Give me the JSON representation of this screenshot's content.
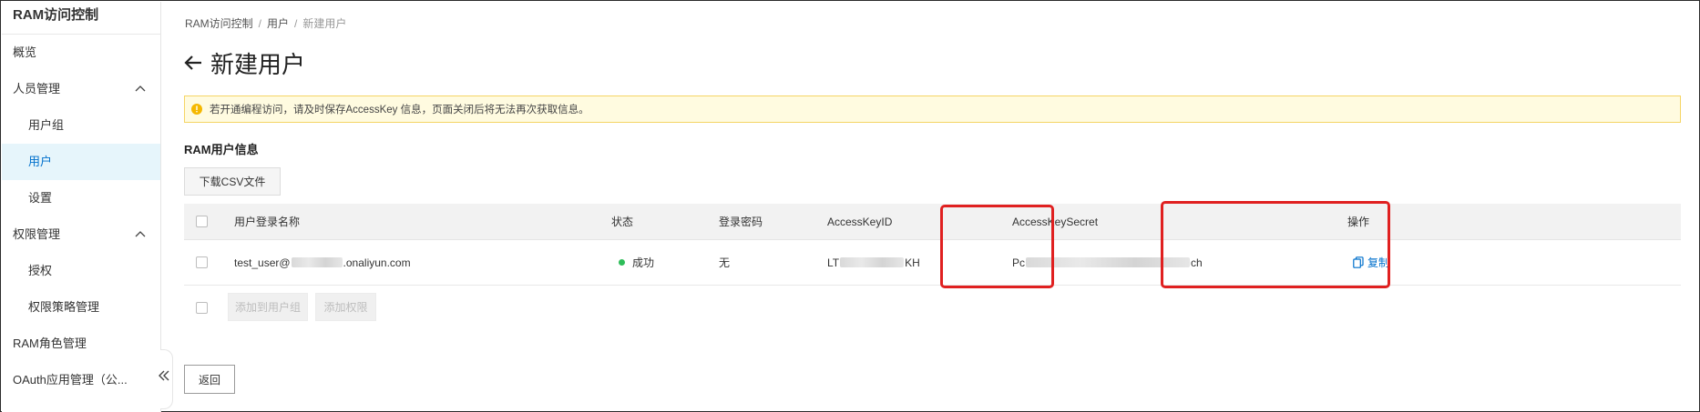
{
  "sidebar": {
    "title": "RAM访问控制",
    "items": [
      {
        "label": "概览",
        "level": 0,
        "active": false,
        "expandable": false
      },
      {
        "label": "人员管理",
        "level": 0,
        "active": false,
        "expandable": true
      },
      {
        "label": "用户组",
        "level": 1,
        "active": false,
        "expandable": false
      },
      {
        "label": "用户",
        "level": 1,
        "active": true,
        "expandable": false
      },
      {
        "label": "设置",
        "level": 1,
        "active": false,
        "expandable": false
      },
      {
        "label": "权限管理",
        "level": 0,
        "active": false,
        "expandable": true
      },
      {
        "label": "授权",
        "level": 1,
        "active": false,
        "expandable": false
      },
      {
        "label": "权限策略管理",
        "level": 1,
        "active": false,
        "expandable": false
      },
      {
        "label": "RAM角色管理",
        "level": 0,
        "active": false,
        "expandable": false
      },
      {
        "label": "OAuth应用管理（公...",
        "level": 0,
        "active": false,
        "expandable": false
      }
    ],
    "collapse_icon": "double-chevron-left-icon"
  },
  "breadcrumb": {
    "items": [
      "RAM访问控制",
      "用户"
    ],
    "current": "新建用户",
    "separator": "/"
  },
  "page": {
    "title": "新建用户",
    "back_icon": "arrow-left-icon"
  },
  "alert": {
    "icon": "warning-circle-icon",
    "text": "若开通编程访问，请及时保存AccessKey 信息，页面关闭后将无法再次获取信息。"
  },
  "section": {
    "title": "RAM用户信息",
    "download_button": "下载CSV文件"
  },
  "table": {
    "columns": [
      "用户登录名称",
      "状态",
      "登录密码",
      "AccessKeyID",
      "AccessKeySecret",
      "操作"
    ],
    "rows": [
      {
        "login_prefix": "test_user@",
        "login_suffix": ".onaliyun.com",
        "status": "成功",
        "password": "无",
        "key_id_prefix": "LT",
        "key_id_suffix": "KH",
        "secret_prefix": "Pc",
        "secret_suffix": "ch",
        "action": "复制"
      }
    ],
    "footer_buttons": [
      "添加到用户组",
      "添加权限"
    ]
  },
  "back_button": "返回",
  "colors": {
    "accent": "#0070cc",
    "active_bg": "#e6f5fb",
    "alert_bg": "#fffbe0",
    "alert_border": "#f5d565",
    "success": "#2ebd59",
    "highlight": "#e02020"
  }
}
